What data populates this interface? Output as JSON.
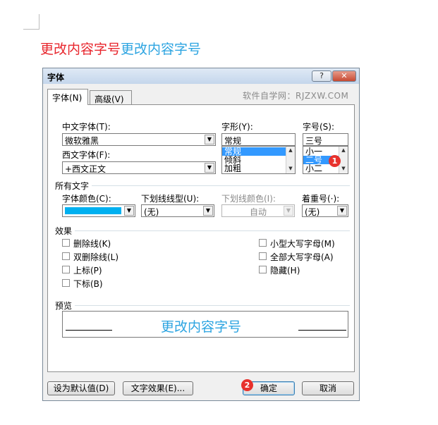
{
  "document": {
    "text_red": "更改内容字号",
    "text_blue": "更改内容字号"
  },
  "dialog": {
    "title": "字体",
    "help_btn": "?",
    "close_btn": "✕",
    "tabs": [
      {
        "label": "字体(N)"
      },
      {
        "label": "高级(V)"
      }
    ],
    "watermark": "软件自学网：RJZXW.COM",
    "chinese_font": {
      "label": "中文字体(T):",
      "value": "微软雅黑"
    },
    "western_font": {
      "label": "西文字体(F):",
      "value": "+西文正文"
    },
    "style": {
      "label": "字形(Y):",
      "value": "常规",
      "options": [
        "常规",
        "倾斜",
        "加粗"
      ],
      "selected_index": 0
    },
    "size": {
      "label": "字号(S):",
      "value": "三号",
      "options": [
        "小一",
        "二号",
        "小二"
      ],
      "selected_index": 1
    },
    "all_text": {
      "section": "所有文字",
      "font_color": {
        "label": "字体颜色(C):",
        "color": "#00b0f0"
      },
      "underline_type": {
        "label": "下划线线型(U):",
        "value": "(无)"
      },
      "underline_color": {
        "label": "下划线颜色(I):",
        "value": "自动"
      },
      "emphasis": {
        "label": "着重号(·):",
        "value": "(无)"
      }
    },
    "effects": {
      "section": "效果",
      "left": [
        "删除线(K)",
        "双删除线(L)",
        "上标(P)",
        "下标(B)"
      ],
      "right": [
        "小型大写字母(M)",
        "全部大写字母(A)",
        "隐藏(H)"
      ]
    },
    "preview": {
      "section": "预览",
      "sample": "更改内容字号"
    },
    "buttons": {
      "set_default": "设为默认值(D)",
      "text_effects": "文字效果(E)...",
      "ok": "确定",
      "cancel": "取消"
    },
    "badges": {
      "one": "1",
      "two": "2"
    }
  }
}
